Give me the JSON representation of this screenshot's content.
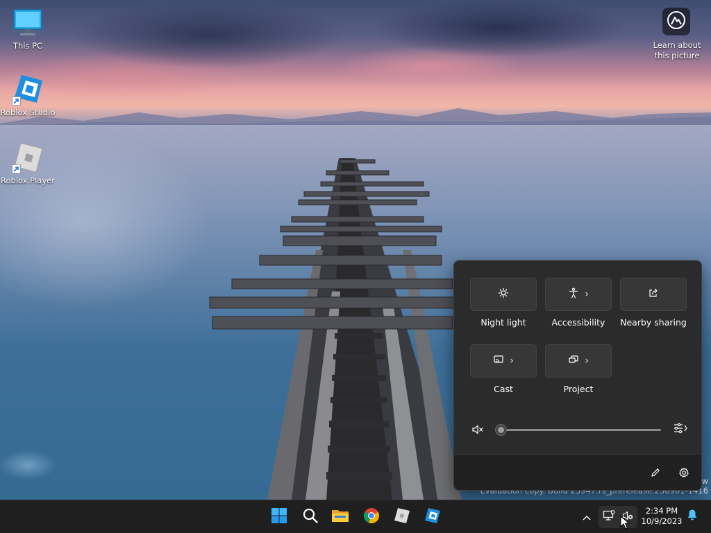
{
  "desktop": {
    "icons": [
      {
        "label": "This PC"
      },
      {
        "label": "Roblox Studio"
      },
      {
        "label": "Roblox Player"
      }
    ],
    "spotlight": {
      "label": "Learn about this picture"
    },
    "watermark": {
      "line1": "w",
      "line2": "Evaluation copy. Build 25947.rs_prerelease.230901-1416"
    }
  },
  "quick_settings": {
    "tiles": [
      {
        "label": "Night light",
        "icon": "night-light-icon",
        "has_chevron": false
      },
      {
        "label": "Accessibility",
        "icon": "accessibility-icon",
        "has_chevron": true
      },
      {
        "label": "Nearby sharing",
        "icon": "nearby-sharing-icon",
        "has_chevron": false
      },
      {
        "label": "Cast",
        "icon": "cast-icon",
        "has_chevron": true
      },
      {
        "label": "Project",
        "icon": "project-icon",
        "has_chevron": true
      }
    ],
    "chevron": "›",
    "volume": {
      "level": 0,
      "muted": true,
      "icon": "speaker-muted-icon"
    },
    "footer": {
      "edit_icon": "pencil-icon",
      "settings_icon": "gear-icon"
    }
  },
  "taskbar": {
    "apps": [
      {
        "name": "start",
        "icon": "windows-logo-icon"
      },
      {
        "name": "search",
        "icon": "search-icon"
      },
      {
        "name": "file-explorer",
        "icon": "folder-icon"
      },
      {
        "name": "chrome",
        "icon": "chrome-icon"
      },
      {
        "name": "roblox-player",
        "icon": "roblox-player-icon"
      },
      {
        "name": "roblox-studio",
        "icon": "roblox-studio-icon"
      }
    ],
    "tray": {
      "overflow_glyph": "^",
      "network_icon": "network-icon",
      "volume_icon": "speaker-muted-icon",
      "time": "2:34 PM",
      "date": "10/9/2023",
      "notification_icon": "bell-icon"
    }
  },
  "colors": {
    "flyout_bg": "#2b2b2b",
    "tile_bg": "#373737",
    "taskbar_bg": "#1f1f1f",
    "accent": "#4cc2ff"
  }
}
